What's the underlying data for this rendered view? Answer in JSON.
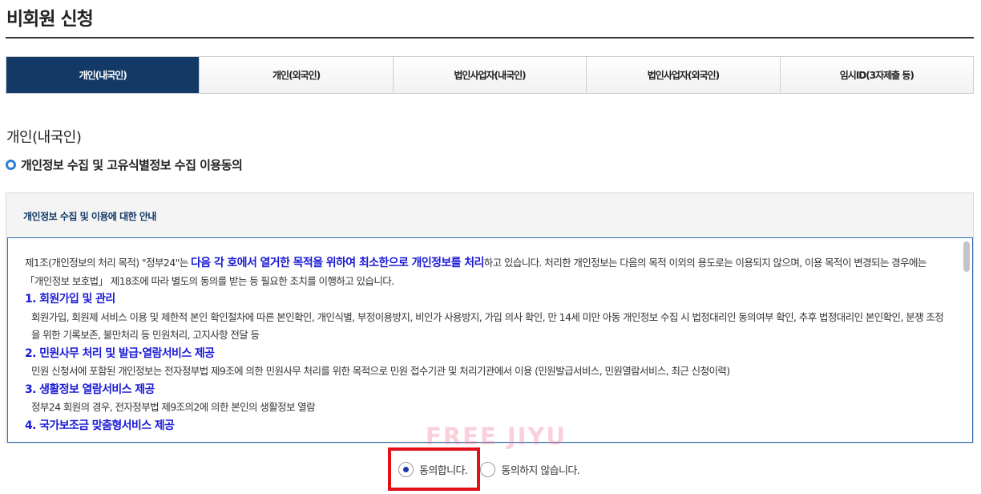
{
  "page": {
    "title": "비회원 신청"
  },
  "tabs": [
    {
      "label": "개인(내국인)",
      "active": true
    },
    {
      "label": "개인(외국인)",
      "active": false
    },
    {
      "label": "법인사업자(내국인)",
      "active": false
    },
    {
      "label": "법인사업자(외국인)",
      "active": false
    },
    {
      "label": "임시ID(3자제출 등)",
      "active": false
    }
  ],
  "section": {
    "heading": "개인(내국인)",
    "subheading": "개인정보 수집 및 고유식별정보 수집 이용동의"
  },
  "guide": {
    "title": "개인정보 수집 및 이용에 대한 안내",
    "intro_prefix": "제1조(개인정보의 처리 목적) \"정부24\"는 ",
    "intro_strong": "다음 각 호에서 열거한 목적을 위하여 최소한으로 개인정보를 처리",
    "intro_suffix": "하고 있습니다. 처리한 개인정보는 다음의 목적 이외의 용도로는 이용되지 않으며, 이용 목적이 변경되는 경우에는 「개인정보 보호법」 제18조에 따라 별도의 동의를 받는 등 필요한 조치를 이행하고 있습니다.",
    "items": [
      {
        "title": "1. 회원가입 및 관리",
        "body": "회원가입, 회원제 서비스 이용 및 제한적 본인 확인절차에 따른 본인확인, 개인식별, 부정이용방지, 비인가 사용방지, 가입 의사 확인, 만 14세 미만 아동 개인정보 수집 시 법정대리인 동의여부 확인, 추후 법정대리인 본인확인, 분쟁 조정을 위한 기록보존, 불만처리 등 민원처리, 고지사항 전달 등"
      },
      {
        "title": "2. 민원사무 처리 및 발급·열람서비스 제공",
        "body": "민원 신청서에 포함된 개인정보는 전자정부법 제9조에 의한 민원사무 처리를 위한 목적으로 민원 접수기관 및 처리기관에서 이용 (민원발급서비스, 민원열람서비스, 최근 신청이력)"
      },
      {
        "title": "3. 생활정보 열람서비스 제공",
        "body": "정부24 회원의 경우, 전자정부법 제9조의2에 의한 본인의 생활정보 열람"
      },
      {
        "title": "4. 국가보조금 맞춤형서비스 제공",
        "body": ""
      }
    ]
  },
  "watermark": "FREE JIYU",
  "consent": {
    "agree_label": "동의합니다.",
    "disagree_label": "동의하지 않습니다.",
    "selected": "agree"
  },
  "colors": {
    "tab_active": "#133a66",
    "accent_blue": "#1a1ad6",
    "highlight_red": "#e3101a"
  }
}
